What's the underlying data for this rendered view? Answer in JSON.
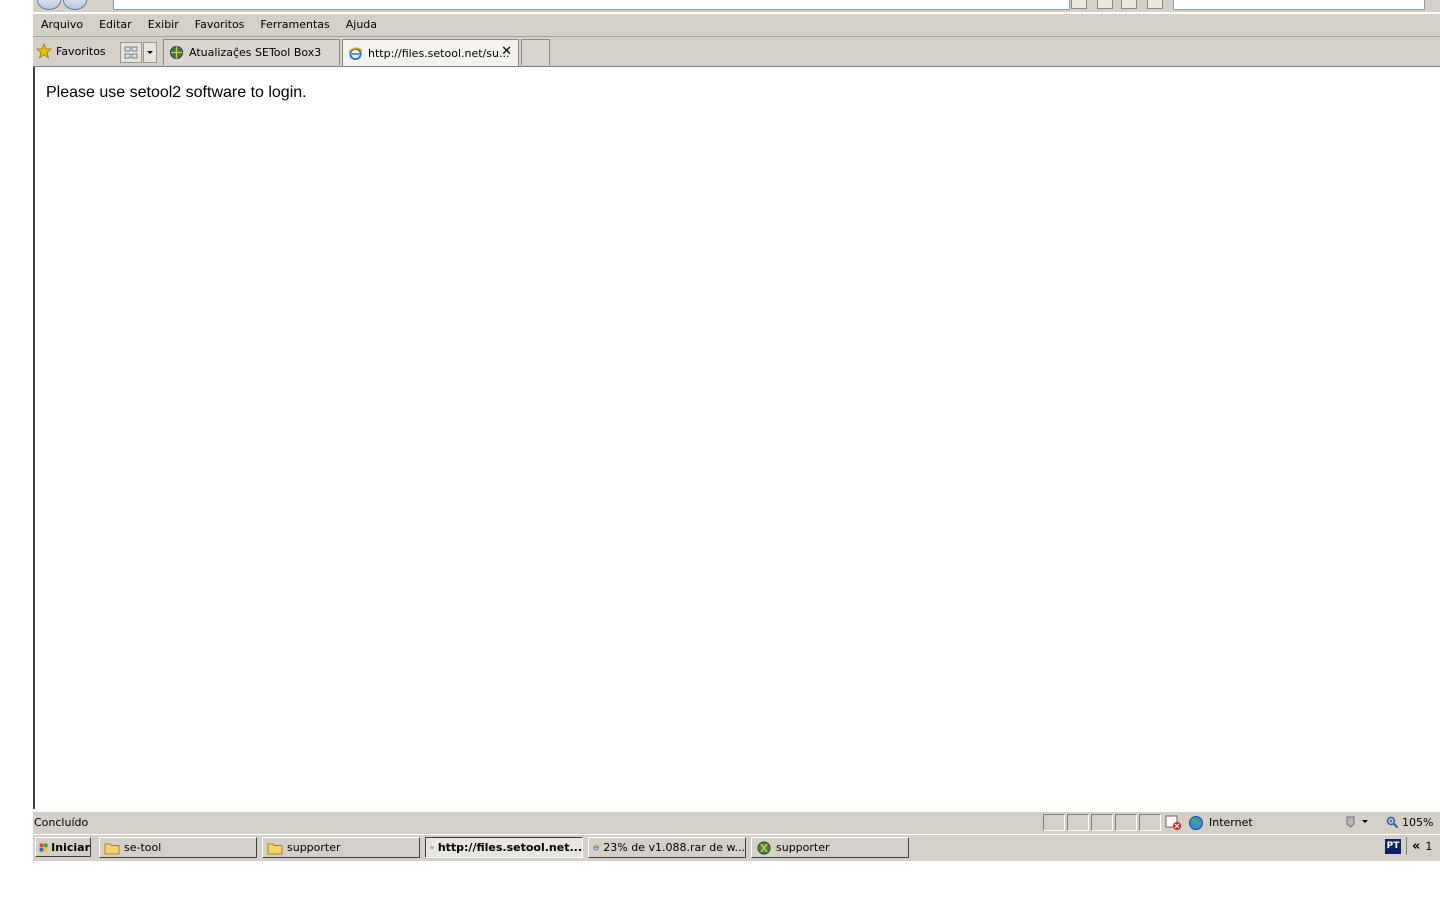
{
  "menubar": {
    "items": [
      "Arquivo",
      "Editar",
      "Exibir",
      "Favoritos",
      "Ferramentas",
      "Ajuda"
    ]
  },
  "tabbar": {
    "favorites_label": "Favoritos",
    "tabs": [
      {
        "title": "Atualizaç̂es SETool Box3",
        "active": false
      },
      {
        "title": "http://files.setool.net/su...",
        "active": true
      }
    ]
  },
  "content": {
    "message": "Please use setool2 software to login."
  },
  "statusbar": {
    "status": "Concluído",
    "zone": "Internet",
    "zoom": "105%"
  },
  "taskbar": {
    "start_label": "Iniciar",
    "buttons": [
      {
        "label": "se-tool",
        "icon": "folder-icon",
        "active": false
      },
      {
        "label": "supporter",
        "icon": "folder-icon",
        "active": false
      },
      {
        "label": "http://files.setool.net...",
        "icon": "ie-icon",
        "active": true
      },
      {
        "label": "23% de v1.088.rar de w...",
        "icon": "ie-icon",
        "active": false
      },
      {
        "label": "supporter",
        "icon": "app-icon",
        "active": false
      }
    ],
    "tray": {
      "language": "PT",
      "chevron": "«",
      "clock_partial": "1"
    }
  }
}
